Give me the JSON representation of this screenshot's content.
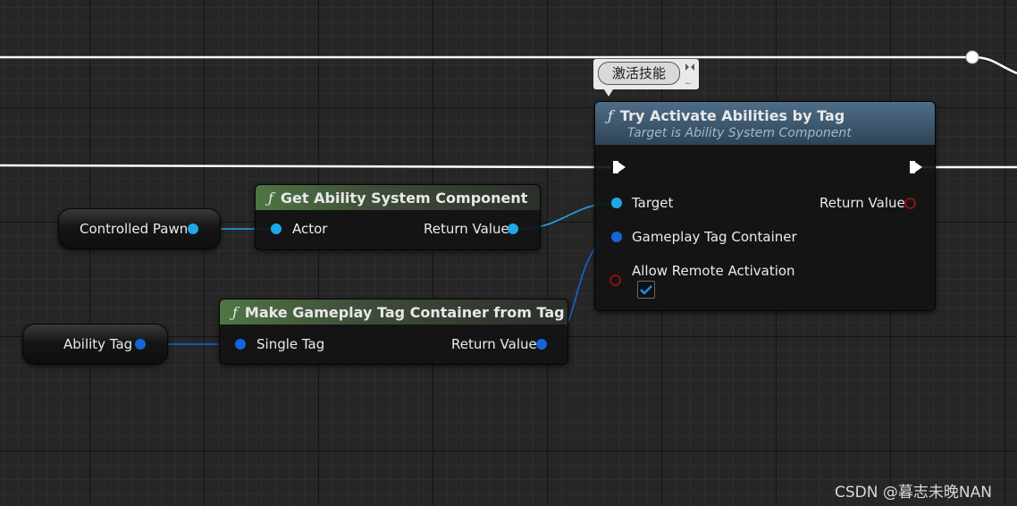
{
  "comment": {
    "text": "激活技能"
  },
  "nodes": {
    "try_activate": {
      "title": "Try Activate Abilities by Tag",
      "subtitle": "Target is Ability System Component",
      "icon": "function-icon",
      "pins": {
        "target": "Target",
        "return_value": "Return Value",
        "gameplay_tag_container": "Gameplay Tag Container",
        "allow_remote_activation": "Allow Remote Activation"
      },
      "allow_remote_activation_checked": true
    },
    "get_asc": {
      "title": "Get Ability System Component",
      "icon": "function-icon",
      "pins": {
        "actor": "Actor",
        "return_value": "Return Value"
      }
    },
    "make_tag_container": {
      "title": "Make Gameplay Tag Container from Tag",
      "icon": "function-icon",
      "pins": {
        "single_tag": "Single Tag",
        "return_value": "Return Value"
      }
    },
    "controlled_pawn": {
      "label": "Controlled Pawn"
    },
    "ability_tag": {
      "label": "Ability Tag"
    }
  },
  "function_glyph": "ƒ",
  "colors": {
    "exec_wire": "#ffffff",
    "object_pin": "#1ea8e8",
    "struct_pin": "#1565d8",
    "bool_pin": "#8b0f14"
  },
  "watermark": "CSDN @暮志未晚NAN"
}
